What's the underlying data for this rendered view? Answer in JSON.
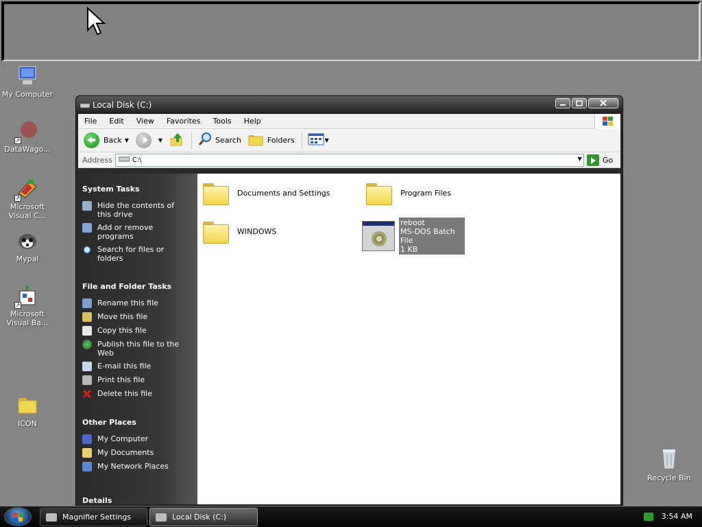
{
  "desktop": {
    "icons": [
      {
        "label": "My Computer"
      },
      {
        "label": "DataWago..."
      },
      {
        "label_line1": "Microsoft",
        "label_line2": "Visual C..."
      },
      {
        "label": "Mypal"
      },
      {
        "label_line1": "Microsoft",
        "label_line2": "Visual Ba..."
      },
      {
        "label": "ICON"
      }
    ],
    "recycle_bin": "Recycle Bin"
  },
  "window": {
    "title": "Local Disk (C:)",
    "menu": [
      "File",
      "Edit",
      "View",
      "Favorites",
      "Tools",
      "Help"
    ],
    "toolbar": {
      "back": "Back",
      "search": "Search",
      "folders": "Folders"
    },
    "address": {
      "label": "Address",
      "value": "C:\\",
      "go": "Go"
    },
    "taskpane": {
      "system_tasks": {
        "title": "System Tasks",
        "items": [
          "Hide the contents of this drive",
          "Add or remove programs",
          "Search for files or folders"
        ]
      },
      "file_folder_tasks": {
        "title": "File and Folder Tasks",
        "items": [
          "Rename this file",
          "Move this file",
          "Copy this file",
          "Publish this file to the Web",
          "E-mail this file",
          "Print this file",
          "Delete this file"
        ]
      },
      "other_places": {
        "title": "Other Places",
        "items": [
          "My Computer",
          "My Documents",
          "My Network Places"
        ]
      },
      "details": {
        "title": "Details"
      }
    },
    "files": [
      {
        "name": "Documents and Settings",
        "type": "folder"
      },
      {
        "name": "Program Files",
        "type": "folder"
      },
      {
        "name": "WINDOWS",
        "type": "folder"
      },
      {
        "name": "reboot",
        "type_label": "MS-DOS Batch File",
        "size": "1 KB"
      }
    ]
  },
  "taskbar": {
    "buttons": [
      {
        "label": "Magnifier Settings"
      },
      {
        "label": "Local Disk (C:)"
      }
    ],
    "clock": "3:54 AM"
  }
}
